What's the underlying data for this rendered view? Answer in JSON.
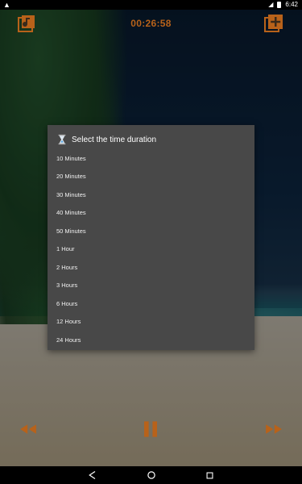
{
  "status_bar": {
    "time": "6:42",
    "left_icon": "warning-icon",
    "right_icons": [
      "signal-icon",
      "battery-icon"
    ]
  },
  "top_bar": {
    "timer": "00:26:58",
    "left_icon": "music-note-icon",
    "right_icon": "add-playlist-icon"
  },
  "dialog": {
    "title": "Select the time duration",
    "title_icon": "hourglass-icon",
    "options": [
      "10 Minutes",
      "20 Minutes",
      "30 Minutes",
      "40 Minutes",
      "50 Minutes",
      "1 Hour",
      "2 Hours",
      "3 Hours",
      "6 Hours",
      "12 Hours",
      "24 Hours"
    ]
  },
  "controls": {
    "rewind_icon": "rewind-icon",
    "pause_icon": "pause-icon",
    "forward_icon": "fast-forward-icon"
  },
  "navigation": {
    "back_icon": "back-icon",
    "home_icon": "home-icon",
    "recents_icon": "recents-icon"
  },
  "colors": {
    "accent": "#b8621a",
    "dialog_bg": "#484848",
    "dialog_text": "#f0f0f0"
  }
}
